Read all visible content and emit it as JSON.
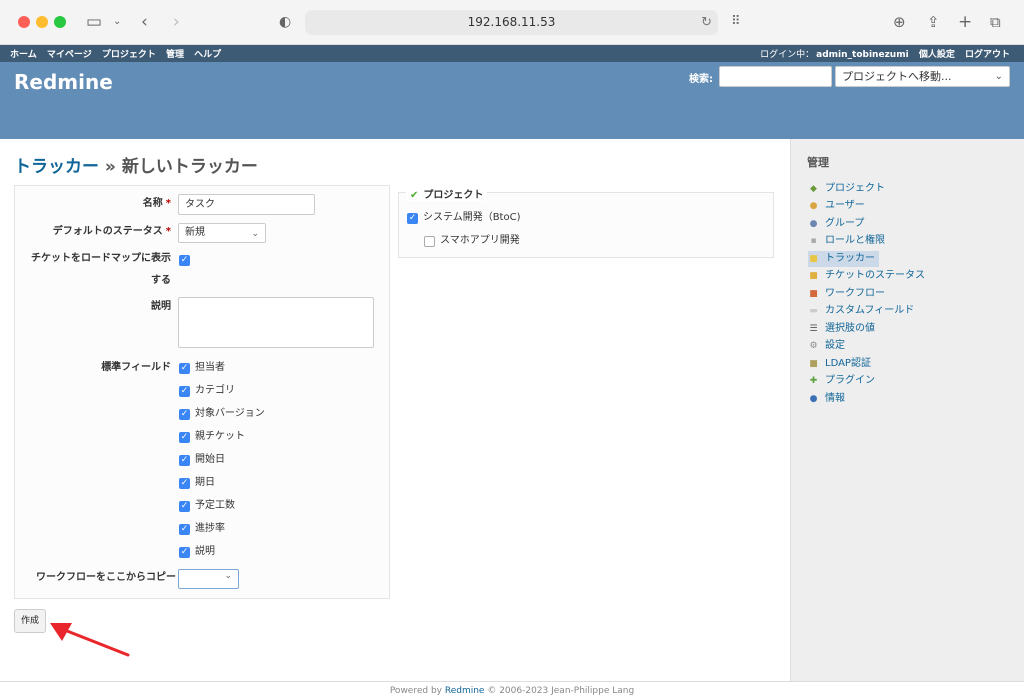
{
  "browser": {
    "url": "192.168.11.53",
    "icons": {
      "sidebar": "sidebar-icon",
      "back": "back-icon",
      "forward": "forward-icon",
      "shield": "shield-icon",
      "reload": "reload-icon",
      "grid": "grid-icon",
      "download": "download-icon",
      "share": "share-icon",
      "new_tab": "plus-icon",
      "tabs": "tabs-icon"
    }
  },
  "top_menu": {
    "items": [
      "ホーム",
      "マイページ",
      "プロジェクト",
      "管理",
      "ヘルプ"
    ],
    "logged_in_label": "ログイン中：",
    "user": "admin_tobinezumi",
    "my_account": "個人設定",
    "logout": "ログアウト"
  },
  "header": {
    "title": "Redmine",
    "search_label": "検索:",
    "search_value": "",
    "jump_placeholder": "プロジェクトへ移動..."
  },
  "page": {
    "breadcrumb_link": "トラッカー",
    "separator": " » ",
    "title": "新しいトラッカー"
  },
  "form": {
    "name_label": "名称",
    "name_value": "タスク",
    "default_status_label": "デフォルトのステータス",
    "default_status_value": "新規",
    "roadmap_label_1": "チケットをロードマップに表示",
    "roadmap_label_2": "する",
    "roadmap_checked": true,
    "description_label": "説明",
    "description_value": "",
    "standard_fields_label": "標準フィールド",
    "standard_fields": [
      "担当者",
      "カテゴリ",
      "対象バージョン",
      "親チケット",
      "開始日",
      "期日",
      "予定工数",
      "進捗率",
      "説明"
    ],
    "copy_workflow_label": "ワークフローをここからコピー",
    "copy_workflow_value": "",
    "required_mark": "*"
  },
  "projects": {
    "legend": "プロジェクト",
    "items": [
      {
        "label": "システム開発（BtoC)",
        "checked": true
      },
      {
        "label": "スマホアプリ開発",
        "checked": false
      }
    ]
  },
  "create_button": "作成",
  "sidebar": {
    "title": "管理",
    "items": [
      {
        "label": "プロジェクト",
        "icon": "projects-icon",
        "color": "#6a9a3a"
      },
      {
        "label": "ユーザー",
        "icon": "user-icon",
        "color": "#d9a441"
      },
      {
        "label": "グループ",
        "icon": "group-icon",
        "color": "#6b86b0"
      },
      {
        "label": "ロールと権限",
        "icon": "key-icon",
        "color": "#aaaaaa"
      },
      {
        "label": "トラッカー",
        "icon": "tracker-icon",
        "color": "#e8c545"
      },
      {
        "label": "チケットのステータス",
        "icon": "status-icon",
        "color": "#e0b040"
      },
      {
        "label": "ワークフロー",
        "icon": "workflow-icon",
        "color": "#d46a3c"
      },
      {
        "label": "カスタムフィールド",
        "icon": "custom-field-icon",
        "color": "#cccccc"
      },
      {
        "label": "選択肢の値",
        "icon": "list-icon",
        "color": "#555555"
      },
      {
        "label": "設定",
        "icon": "settings-icon",
        "color": "#888888"
      },
      {
        "label": "LDAP認証",
        "icon": "ldap-icon",
        "color": "#b0a060"
      },
      {
        "label": "プラグイン",
        "icon": "plugin-icon",
        "color": "#5aa040"
      },
      {
        "label": "情報",
        "icon": "info-icon",
        "color": "#3b6fb6"
      }
    ],
    "selected": "トラッカー"
  },
  "footer": {
    "prefix": "Powered by ",
    "link": "Redmine",
    "suffix": " © 2006-2023 Jean-Philippe Lang"
  },
  "colors": {
    "top_menu": "#3e5b76",
    "header": "#628db6",
    "link": "#169",
    "arrow": "#e8262b"
  }
}
